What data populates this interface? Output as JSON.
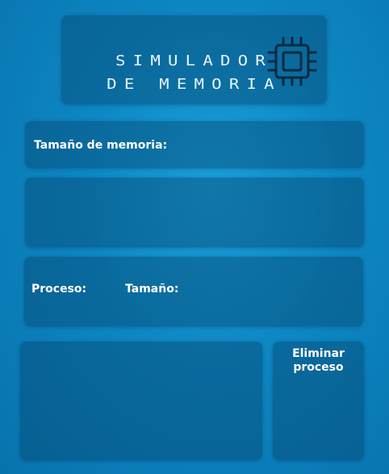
{
  "header": {
    "title_line1": "SIMULADOR",
    "title_line2": "DE MEMORIA",
    "icon": "memory-chip-icon"
  },
  "memory": {
    "size_label": "Tamaño de memoria:",
    "size_value": ""
  },
  "process": {
    "name_label": "Proceso:",
    "name_value": "",
    "size_label": "Tamaño:",
    "size_value": ""
  },
  "actions": {
    "delete_label": "Eliminar\nproceso"
  },
  "colors": {
    "background": "#0d86c2",
    "panel": "#06466e",
    "text": "#ffffff"
  }
}
